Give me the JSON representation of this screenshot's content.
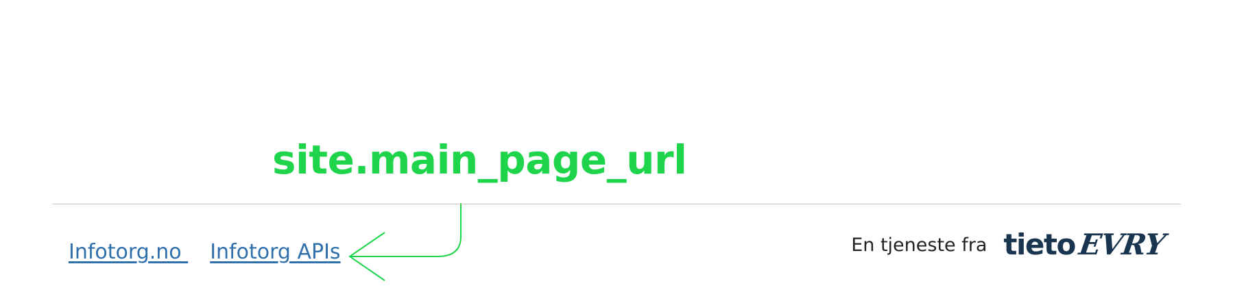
{
  "annotation": {
    "label": "site.main_page_url",
    "color": "#1ed44a"
  },
  "footer": {
    "links": [
      {
        "label": "Infotorg.no "
      },
      {
        "label": "Infotorg APIs"
      }
    ],
    "link_color": "#2f6fab",
    "provider_text": "En tjeneste fra",
    "logo": {
      "part1": "tieto",
      "part2": "EVRY",
      "color": "#1a3550"
    }
  }
}
